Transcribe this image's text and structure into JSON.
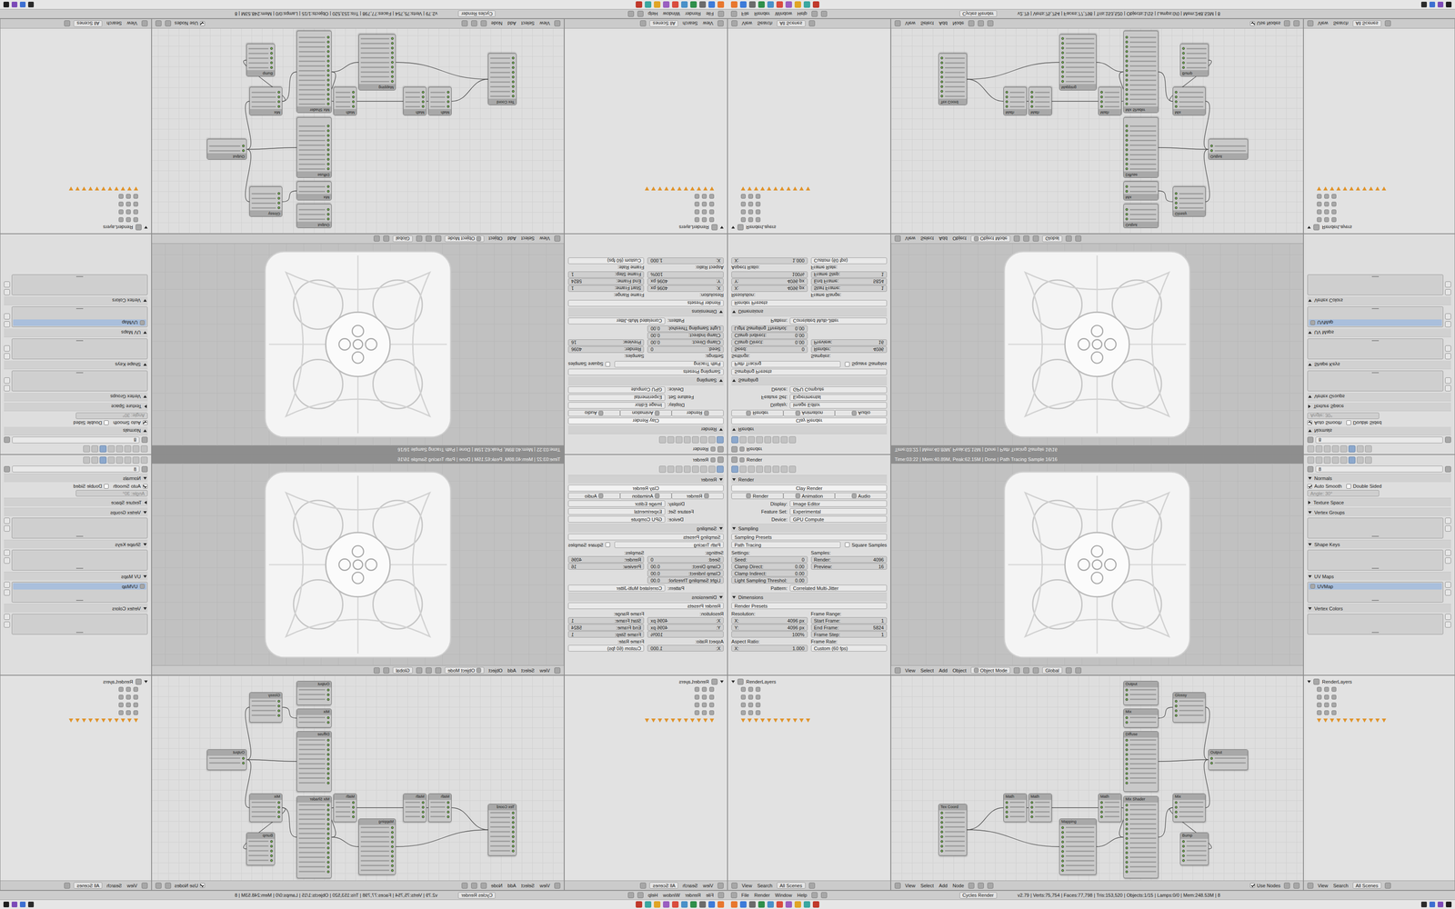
{
  "render_props": {
    "context": "Render",
    "tabs": [
      {
        "selected": true
      },
      {
        "selected": false
      },
      {
        "selected": false
      },
      {
        "selected": false
      },
      {
        "selected": false
      },
      {
        "selected": false
      },
      {
        "selected": false
      },
      {
        "selected": false
      }
    ],
    "title": "Render",
    "expanded": true,
    "preset": "Clay Render",
    "buttons": [
      "Render",
      "Animation",
      "Audio"
    ],
    "fields": [
      {
        "label": "Display:",
        "value": "Image Editor"
      },
      {
        "label": "Feature Set:",
        "value": "Experimental"
      },
      {
        "label": "Device:",
        "value": "GPU Compute"
      }
    ],
    "sampling": {
      "title": "Sampling",
      "expanded": true,
      "presets": "Sampling Presets",
      "integrator": "Path Tracing",
      "square": {
        "label": "Square Samples",
        "checked": false
      },
      "left": [
        {
          "kind": "heading",
          "label": "Settings:",
          "value": ""
        },
        {
          "kind": "number",
          "label": "Seed:",
          "value": "0"
        },
        {
          "kind": "number",
          "label": "Clamp Direct:",
          "value": "0.00"
        },
        {
          "kind": "number",
          "label": "Clamp Indirect:",
          "value": "0.00"
        },
        {
          "kind": "number",
          "label": "Light Sampling Threshol:",
          "value": "0.00"
        }
      ],
      "right": [
        {
          "kind": "heading",
          "label": "Samples:",
          "value": ""
        },
        {
          "kind": "number",
          "label": "Render:",
          "value": "4096"
        },
        {
          "kind": "number",
          "label": "Preview:",
          "value": "16"
        }
      ],
      "pattern": {
        "label": "Pattern:",
        "value": "Correlated Multi-Jitter"
      }
    },
    "dimensions": {
      "title": "Dimensions",
      "expanded": true,
      "presets": "Render Presets",
      "left": [
        {
          "kind": "heading",
          "label": "Resolution:",
          "value": ""
        },
        {
          "kind": "number",
          "label": "X:",
          "value": "4096 px"
        },
        {
          "kind": "number",
          "label": "Y:",
          "value": "4096 px"
        },
        {
          "kind": "number",
          "label": "",
          "value": "100%"
        },
        {
          "kind": "heading",
          "label": "Aspect Ratio:",
          "value": ""
        },
        {
          "kind": "number",
          "label": "X:",
          "value": "1.000"
        }
      ],
      "right": [
        {
          "kind": "heading",
          "label": "Frame Range:",
          "value": ""
        },
        {
          "kind": "number",
          "label": "Start Frame:",
          "value": "1"
        },
        {
          "kind": "number",
          "label": "End Frame:",
          "value": "5824"
        },
        {
          "kind": "number",
          "label": "Frame Step:",
          "value": "1"
        },
        {
          "kind": "heading",
          "label": "Frame Rate:",
          "value": ""
        },
        {
          "kind": "field",
          "label": "",
          "value": "Custom (60 fps)"
        }
      ]
    }
  },
  "viewport": {
    "status": "Time:03:22 | Mem:40.89M, Peak:62.15M | Done | Path Tracing Sample 16/16",
    "menus": [
      "View",
      "Select",
      "Add",
      "Object"
    ],
    "mode": "Object Mode",
    "orientation": "Global"
  },
  "mesh_props": {
    "tabs": [
      {
        "selected": false
      },
      {
        "selected": false
      },
      {
        "selected": false
      },
      {
        "selected": false
      },
      {
        "selected": false
      },
      {
        "selected": true
      },
      {
        "selected": false
      },
      {
        "selected": false
      }
    ],
    "name": "8",
    "normals": {
      "title": "Normals",
      "expanded": true,
      "auto_smooth": {
        "label": "Auto Smooth",
        "checked": true
      },
      "double_sided": {
        "label": "Double Sided",
        "checked": false
      },
      "angle": "Angle: 30°"
    },
    "texture_space": {
      "title": "Texture Space",
      "expanded": false
    },
    "lists": [
      {
        "title": "Vertex Groups",
        "expanded": true,
        "items": []
      },
      {
        "title": "Shape Keys",
        "expanded": true,
        "items": []
      },
      {
        "title": "UV Maps",
        "expanded": true,
        "items": [
          {
            "name": "UVMap",
            "selected": true
          }
        ]
      },
      {
        "title": "Vertex Colors",
        "expanded": true,
        "items": []
      }
    ]
  },
  "outliner": {
    "root": "RenderLayers",
    "expanded": true,
    "children": [
      {
        "visible": true
      },
      {
        "visible": true
      },
      {
        "visible": true
      },
      {
        "visible": true
      }
    ],
    "passes": [
      {
        "enabled": true
      },
      {
        "enabled": true
      },
      {
        "enabled": true
      },
      {
        "enabled": true
      },
      {
        "enabled": true
      },
      {
        "enabled": true
      },
      {
        "enabled": true
      },
      {
        "enabled": true
      },
      {
        "enabled": true
      },
      {
        "enabled": true
      },
      {
        "enabled": true
      }
    ],
    "menus": [
      "View",
      "Search"
    ],
    "scene": "All Scenes"
  },
  "node_editor": {
    "menus": [
      "View",
      "Select",
      "Add",
      "Node"
    ],
    "use_nodes": {
      "label": "Use Nodes",
      "checked": true
    },
    "nodes": [
      {
        "title": "Output"
      },
      {
        "title": "Mix"
      },
      {
        "title": "Diffuse"
      },
      {
        "title": "Mix Shader"
      },
      {
        "title": "Glossy"
      },
      {
        "title": "Mix"
      },
      {
        "title": "Output"
      },
      {
        "title": "Bump"
      },
      {
        "title": "Mapping"
      },
      {
        "title": "Math"
      },
      {
        "title": "Math"
      },
      {
        "title": "Math"
      },
      {
        "title": "Tex Coord"
      }
    ],
    "links": [
      {
        "from": 12,
        "to": 8
      },
      {
        "from": 12,
        "to": 9
      },
      {
        "from": 9,
        "to": 10
      },
      {
        "from": 10,
        "to": 11
      },
      {
        "from": 11,
        "to": 3
      },
      {
        "from": 8,
        "to": 3
      },
      {
        "from": 3,
        "to": 5
      },
      {
        "from": 2,
        "to": 6
      },
      {
        "from": 5,
        "to": 6
      },
      {
        "from": 4,
        "to": 6
      },
      {
        "from": 7,
        "to": 5
      },
      {
        "from": 1,
        "to": 4
      }
    ]
  },
  "info": {
    "menus": [
      "File",
      "Render",
      "Window",
      "Help"
    ],
    "engine": "Cycles Render",
    "stats": "v2.79 | Verts:75,754 | Faces:77,798 | Tris:153,520 | Objects:1/15 | Lamps:0/0 | Mem:248.53M | 8"
  },
  "taskbar": {
    "apps": [
      {
        "color": "#e8772e"
      },
      {
        "color": "#3d7bd9"
      },
      {
        "color": "#6b6b6b"
      },
      {
        "color": "#2f8f4a"
      },
      {
        "color": "#4a90c8"
      },
      {
        "color": "#d94c3d"
      },
      {
        "color": "#9a5fc0"
      },
      {
        "color": "#e0a526"
      },
      {
        "color": "#3aa7a0"
      },
      {
        "color": "#c0392b"
      }
    ],
    "tray": [
      {
        "color": "#2b2b2b"
      },
      {
        "color": "#3d6fd1"
      },
      {
        "color": "#7c4ab8"
      },
      {
        "color": "#1f1f1f"
      }
    ]
  }
}
